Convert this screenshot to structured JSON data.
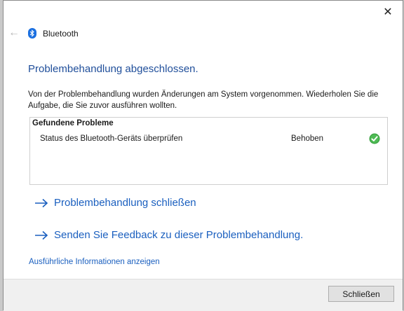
{
  "window": {
    "close_glyph": "✕"
  },
  "titlebar": {
    "back_glyph": "←",
    "title": "Bluetooth",
    "icon": "bluetooth-icon"
  },
  "main": {
    "heading": "Problembehandlung abgeschlossen.",
    "description": "Von der Problembehandlung wurden Änderungen am System vorgenommen. Wiederholen Sie die Aufgabe, die Sie zuvor ausführen wollten."
  },
  "issues": {
    "header": "Gefundene Probleme",
    "rows": [
      {
        "name": "Status des Bluetooth-Geräts überprüfen",
        "status": "Behoben",
        "icon": "check-icon"
      }
    ]
  },
  "links": {
    "close_troubleshooter": "Problembehandlung schließen",
    "send_feedback": "Senden Sie Feedback zu dieser Problembehandlung.",
    "details": "Ausführliche Informationen anzeigen"
  },
  "footer": {
    "close_label": "Schließen"
  },
  "colors": {
    "heading": "#1f4e9a",
    "link": "#1a5fbf",
    "bluetooth": "#1a6fe0",
    "success": "#3aa341"
  }
}
